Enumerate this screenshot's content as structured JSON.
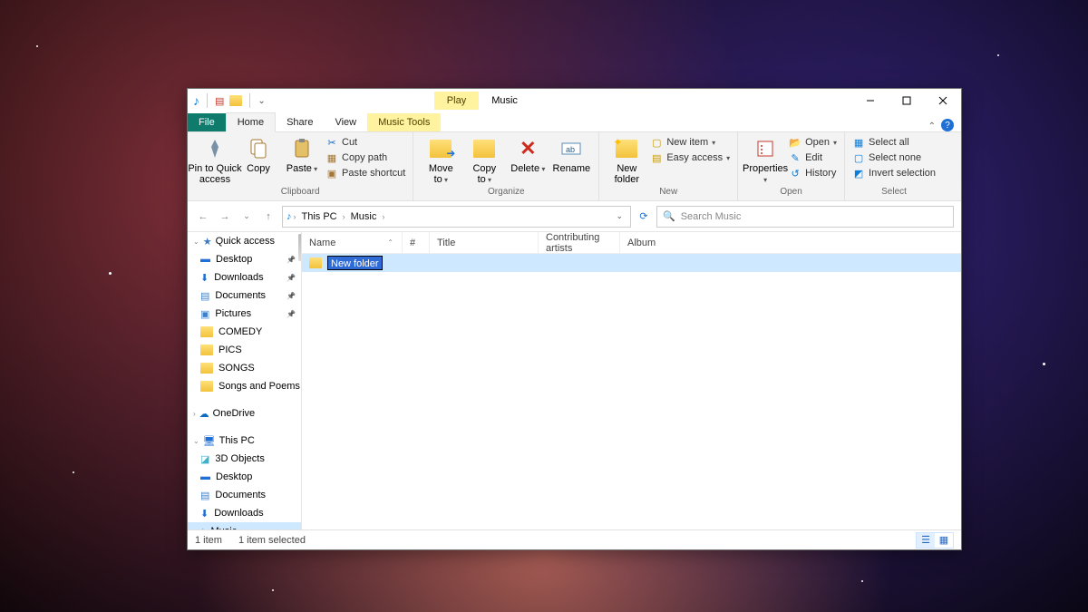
{
  "title_context": "Play",
  "window_title": "Music",
  "tabs": {
    "file": "File",
    "home": "Home",
    "share": "Share",
    "view": "View",
    "tools": "Music Tools"
  },
  "ribbon": {
    "clipboard": {
      "pin": "Pin to Quick\naccess",
      "copy": "Copy",
      "paste": "Paste",
      "cut": "Cut",
      "copypath": "Copy path",
      "pasteshort": "Paste shortcut",
      "label": "Clipboard"
    },
    "organize": {
      "move": "Move\nto",
      "copyto": "Copy\nto",
      "delete": "Delete",
      "rename": "Rename",
      "label": "Organize"
    },
    "new": {
      "folder": "New\nfolder",
      "item": "New item",
      "easy": "Easy access",
      "label": "New"
    },
    "open": {
      "props": "Properties",
      "open": "Open",
      "edit": "Edit",
      "history": "History",
      "label": "Open"
    },
    "select": {
      "all": "Select all",
      "none": "Select none",
      "invert": "Invert selection",
      "label": "Select"
    }
  },
  "breadcrumb": {
    "c1": "This PC",
    "c2": "Music"
  },
  "search_placeholder": "Search Music",
  "sidebar": {
    "quick": "Quick access",
    "desktop": "Desktop",
    "downloads": "Downloads",
    "documents": "Documents",
    "pictures": "Pictures",
    "comedy": "COMEDY",
    "pics": "PICS",
    "songs": "SONGS",
    "sap": "Songs and Poems",
    "onedrive": "OneDrive",
    "thispc": "This PC",
    "threed": "3D Objects",
    "desktop2": "Desktop",
    "documents2": "Documents",
    "downloads2": "Downloads",
    "music": "Music"
  },
  "columns": {
    "name": "Name",
    "num": "#",
    "title": "Title",
    "artists": "Contributing artists",
    "album": "Album"
  },
  "row": {
    "name": "New folder"
  },
  "status": {
    "left": "1 item",
    "sel": "1 item selected"
  }
}
